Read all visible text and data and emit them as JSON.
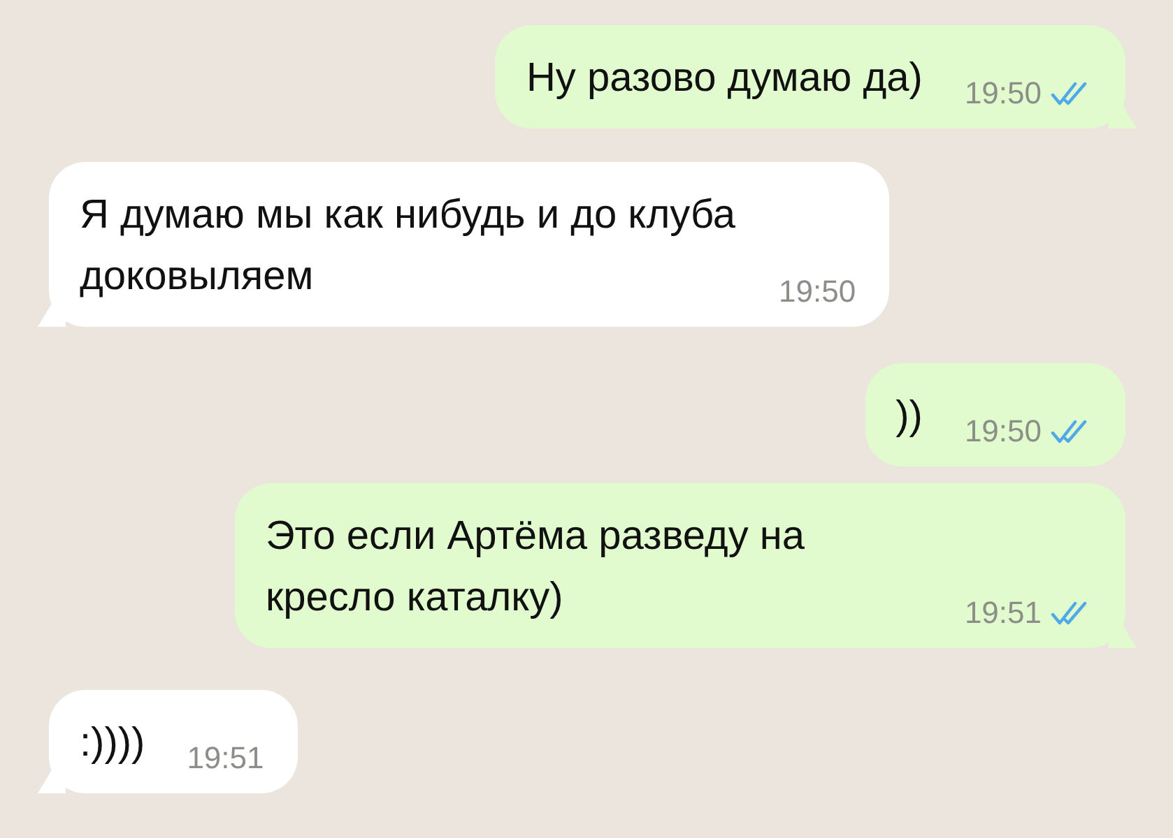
{
  "messages": [
    {
      "kind": "outgoing",
      "text": "Ну разово думаю да)",
      "time": "19:50",
      "read": true,
      "tail": true
    },
    {
      "kind": "incoming",
      "text": "Я думаю мы как нибудь и до клуба доковыляем",
      "time": "19:50",
      "tail": true
    },
    {
      "kind": "outgoing",
      "text": "))",
      "time": "19:50",
      "read": true,
      "tail": false
    },
    {
      "kind": "outgoing",
      "text": "Это если Артёма разведу на кресло каталку)",
      "time": "19:51",
      "read": true,
      "tail": true
    },
    {
      "kind": "incoming",
      "text": ":))))",
      "time": "19:51",
      "tail": true
    }
  ]
}
